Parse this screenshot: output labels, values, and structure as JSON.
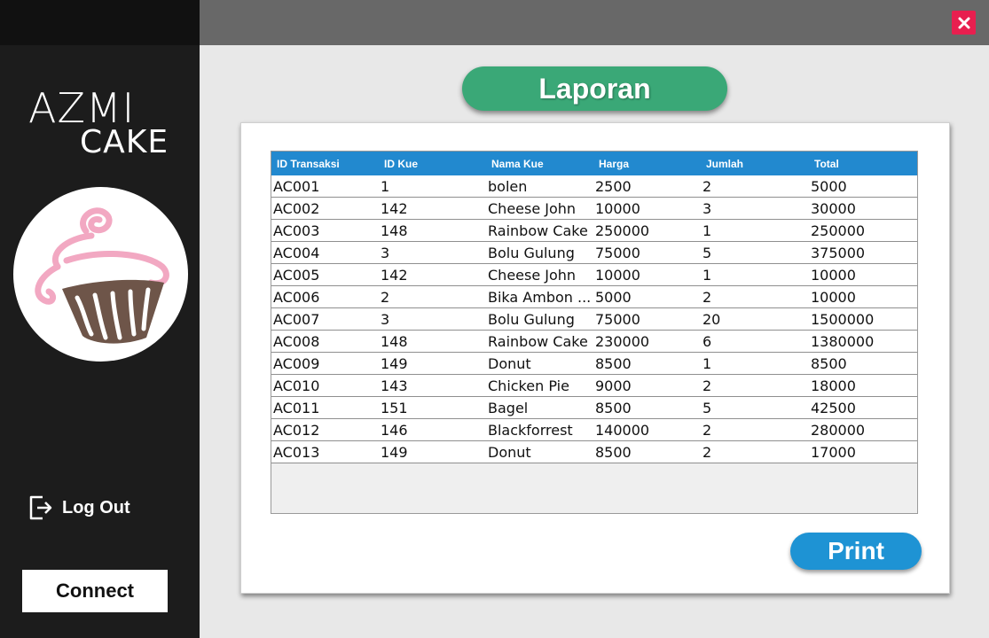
{
  "brand": {
    "line1": "AZMI",
    "line2": "CAKE"
  },
  "sidebar": {
    "logout_label": "Log Out",
    "connect_label": "Connect"
  },
  "header": {
    "title": "Laporan"
  },
  "actions": {
    "print_label": "Print"
  },
  "colors": {
    "accent_green": "#3aa877",
    "accent_blue": "#1e93d4",
    "close_red": "#e81f4f",
    "header_blue": "#2289cf"
  },
  "icons": {
    "close": "close-icon",
    "logout": "logout-icon",
    "logo": "cupcake-logo"
  },
  "table": {
    "columns": [
      "ID Transaksi",
      "ID Kue",
      "Nama Kue",
      "Harga",
      "Jumlah",
      "Total"
    ],
    "rows": [
      [
        "AC001",
        "1",
        "bolen",
        "2500",
        "2",
        "5000"
      ],
      [
        "AC002",
        "142",
        "Cheese John",
        "10000",
        "3",
        "30000"
      ],
      [
        "AC003",
        "148",
        "Rainbow Cake",
        "250000",
        "1",
        "250000"
      ],
      [
        "AC004",
        "3",
        "Bolu Gulung",
        "75000",
        "5",
        "375000"
      ],
      [
        "AC005",
        "142",
        "Cheese John",
        "10000",
        "1",
        "10000"
      ],
      [
        "AC006",
        "2",
        "Bika Ambon ...",
        "5000",
        "2",
        "10000"
      ],
      [
        "AC007",
        "3",
        "Bolu Gulung",
        "75000",
        "20",
        "1500000"
      ],
      [
        "AC008",
        "148",
        "Rainbow Cake",
        "230000",
        "6",
        "1380000"
      ],
      [
        "AC009",
        "149",
        "Donut",
        "8500",
        "1",
        "8500"
      ],
      [
        "AC010",
        "143",
        "Chicken Pie",
        "9000",
        "2",
        "18000"
      ],
      [
        "AC011",
        "151",
        "Bagel",
        "8500",
        "5",
        "42500"
      ],
      [
        "AC012",
        "146",
        "Blackforrest",
        "140000",
        "2",
        "280000"
      ],
      [
        "AC013",
        "149",
        "Donut",
        "8500",
        "2",
        "17000"
      ]
    ]
  }
}
